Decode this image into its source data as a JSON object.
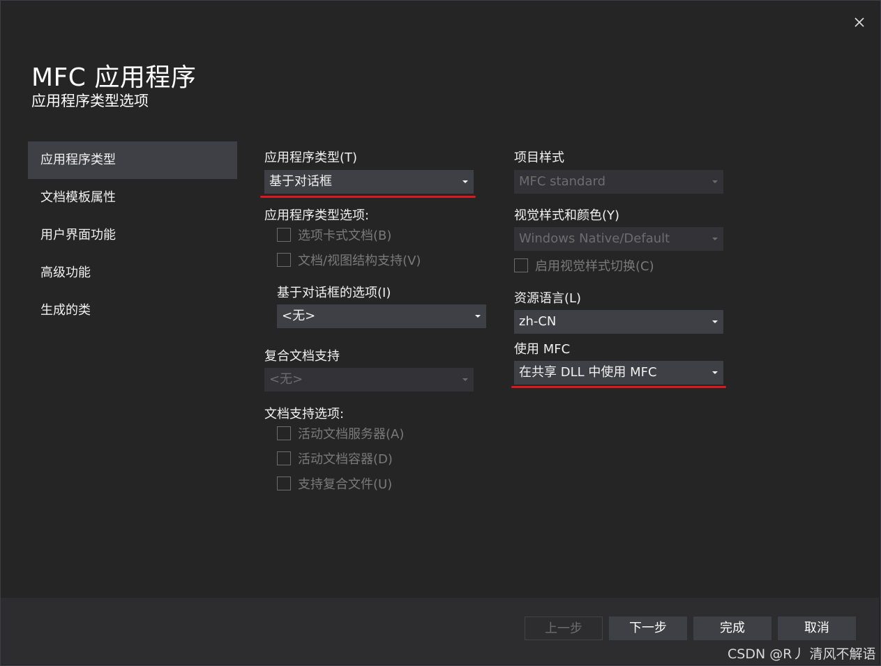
{
  "dialog": {
    "title": "MFC 应用程序",
    "subtitle": "应用程序类型选项"
  },
  "nav": {
    "items": [
      {
        "label": "应用程序类型",
        "active": true
      },
      {
        "label": "文档模板属性"
      },
      {
        "label": "用户界面功能"
      },
      {
        "label": "高级功能"
      },
      {
        "label": "生成的类"
      }
    ]
  },
  "left": {
    "app_type_label": "应用程序类型(T)",
    "app_type_value": "基于对话框",
    "app_type_options_label": "应用程序类型选项:",
    "tabbed_docs": "选项卡式文档(B)",
    "doc_view": "文档/视图结构支持(V)",
    "dialog_options_label": "基于对话框的选项(I)",
    "dialog_options_value": "<无>",
    "compound_label": "复合文档支持",
    "compound_value": "<无>",
    "doc_support_label": "文档支持选项:",
    "active_doc_server": "活动文档服务器(A)",
    "active_doc_container": "活动文档容器(D)",
    "compound_files": "支持复合文件(U)"
  },
  "right": {
    "project_style_label": "项目样式",
    "project_style_value": "MFC standard",
    "visual_style_label": "视觉样式和颜色(Y)",
    "visual_style_value": "Windows Native/Default",
    "enable_visual_switch": "启用视觉样式切换(C)",
    "resource_lang_label": "资源语言(L)",
    "resource_lang_value": "zh-CN",
    "use_mfc_label": "使用 MFC",
    "use_mfc_value": "在共享 DLL 中使用 MFC"
  },
  "footer": {
    "prev": "上一步",
    "next": "下一步",
    "finish": "完成",
    "cancel": "取消"
  },
  "watermark": "CSDN @R丿 清风不解语",
  "colors": {
    "background": "#252526",
    "control": "#3f3f46",
    "annotation_red": "#e0161e"
  }
}
